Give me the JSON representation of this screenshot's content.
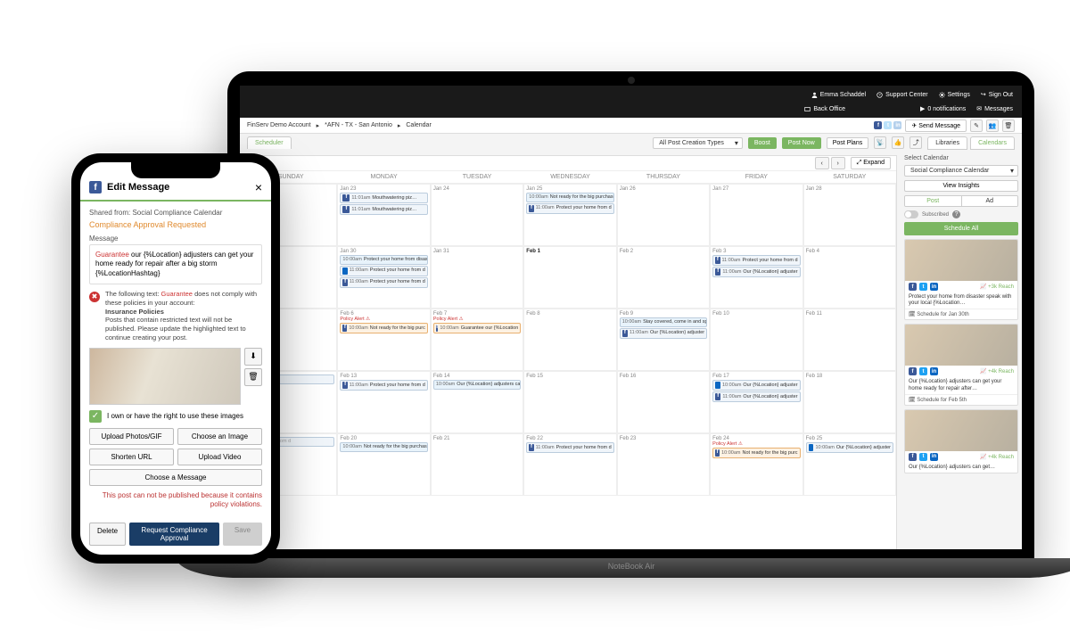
{
  "laptop_model": "NoteBook Air",
  "topbar": {
    "user": "Emma Schaddel",
    "back_office": "Back Office",
    "support": "Support Center",
    "settings": "Settings",
    "notifications": "0 notifications",
    "signout": "Sign Out",
    "messages": "Messages"
  },
  "breadcrumbs": {
    "account": "FinServ Demo Account",
    "location": "*AFN - TX - San Antonio",
    "page": "Calendar",
    "send_message": "Send Message"
  },
  "tabs": {
    "scheduler": "Scheduler",
    "library": "Libraries",
    "calendars": "Calendars"
  },
  "filters": {
    "creation_types": "All Post Creation Types",
    "boost": "Boost",
    "post_now": "Post Now",
    "post_plans": "Post Plans"
  },
  "calheader": {
    "expand": "Expand",
    "days": [
      "SUNDAY",
      "MONDAY",
      "TUESDAY",
      "WEDNESDAY",
      "THURSDAY",
      "FRIDAY",
      "SATURDAY"
    ]
  },
  "weeks": [
    [
      {
        "d": ""
      },
      {
        "d": "Jan 23",
        "ev": [
          {
            "t": "11:01am",
            "x": "Mouthwatering piz…",
            "n": "fb"
          },
          {
            "t": "11:01am",
            "x": "Mouthwatering piz…",
            "n": "fb"
          }
        ]
      },
      {
        "d": "Jan 24"
      },
      {
        "d": "Jan 25",
        "span": {
          "t": "10:00am",
          "x": "Not ready for the big purchase? Speak to {%Location} about our guarantee renters insurance"
        },
        "ev": [
          {
            "t": "11:00am",
            "x": "Protect your home from d",
            "n": "fb"
          }
        ]
      },
      {
        "d": "Jan 26"
      },
      {
        "d": "Jan 27"
      },
      {
        "d": "Jan 28"
      }
    ],
    [
      {
        "d": ""
      },
      {
        "d": "Jan 30",
        "span": {
          "t": "10:00am",
          "x": "Protect your home from disaster speak with your local {%Location} today"
        },
        "ev": [
          {
            "t": "11:00am",
            "x": "Protect your home from d",
            "n": "li"
          },
          {
            "t": "11:00am",
            "x": "Protect your home from d",
            "n": "fb"
          }
        ]
      },
      {
        "d": "Jan 31"
      },
      {
        "d": "Feb 1",
        "bold": true
      },
      {
        "d": "Feb 2"
      },
      {
        "d": "Feb 3",
        "ev": [
          {
            "t": "11:00am",
            "x": "Protect your home from d",
            "n": "fb"
          },
          {
            "t": "11:00am",
            "x": "Our {%Location} adjuster",
            "n": "fb"
          }
        ]
      },
      {
        "d": "Feb 4"
      }
    ],
    [
      {
        "d": ""
      },
      {
        "d": "Feb 6",
        "alert": "Policy Alert ⚠",
        "ev": [
          {
            "t": "10:00am",
            "x": "Not ready for the big purc",
            "n": "fb",
            "a": 1
          }
        ]
      },
      {
        "d": "Feb 7",
        "alert": "Policy Alert ⚠",
        "ev": [
          {
            "t": "10:00am",
            "x": "Guarantee our {%Location",
            "n": "fb",
            "a": 1
          }
        ]
      },
      {
        "d": "Feb 8"
      },
      {
        "d": "Feb 9",
        "span": {
          "t": "10:00am",
          "x": "Stay covered, come in and speak to {%Location} {%LocationLicenseNumber} to get a q"
        },
        "ev": [
          {
            "t": "11:00am",
            "x": "Our {%Location} adjuster",
            "n": "fb"
          }
        ]
      },
      {
        "d": "Feb 10"
      },
      {
        "d": "Feb 11"
      }
    ],
    [
      {
        "d": "",
        "txt": "wered, come i"
      },
      {
        "d": "Feb 13",
        "ev": [
          {
            "t": "11:00am",
            "x": "Protect your home from d",
            "n": "fb"
          }
        ]
      },
      {
        "d": "Feb 14",
        "span": {
          "t": "10:00am",
          "x": "Our {%Location} adjusters can get your home ready for repair after a big storm {%LocationHashtag}"
        }
      },
      {
        "d": "Feb 15"
      },
      {
        "d": "Feb 16"
      },
      {
        "d": "Feb 17",
        "ev": [
          {
            "t": "10:00am",
            "x": "Our {%Location} adjuster",
            "n": "li"
          },
          {
            "t": "11:00am",
            "x": "Our {%Location} adjuster",
            "n": "fb"
          }
        ]
      },
      {
        "d": "Feb 18"
      }
    ],
    [
      {
        "d": "",
        "txt": "t your home from d"
      },
      {
        "d": "Feb 20",
        "span": {
          "t": "10:00am",
          "x": "Not ready for the big purchase? Speak to {%Location} about our guarantee renters insurance"
        }
      },
      {
        "d": "Feb 21"
      },
      {
        "d": "Feb 22",
        "ev": [
          {
            "t": "11:00am",
            "x": "Protect your home from d",
            "n": "fb"
          }
        ]
      },
      {
        "d": "Feb 23"
      },
      {
        "d": "Feb 24",
        "alert": "Policy Alert ⚠",
        "ev": [
          {
            "t": "10:00am",
            "x": "Not ready for the big purc",
            "n": "fb",
            "a": 1
          }
        ]
      },
      {
        "d": "Feb 25",
        "ev": [
          {
            "t": "10:00am",
            "x": "Our {%Location} adjuster",
            "n": "li"
          }
        ]
      }
    ]
  ],
  "sidebar": {
    "select_label": "Select Calendar",
    "calendar": "Social Compliance Calendar",
    "insights": "View Insights",
    "post": "Post",
    "ad": "Ad",
    "subscribed": "Subscribed",
    "schedule_all": "Schedule All",
    "cards": [
      {
        "reach": "+3k Reach",
        "txt": "Protect your home from disaster speak with your local {%Location…",
        "btn": "Schedule for Jan 30th"
      },
      {
        "reach": "+4k Reach",
        "txt": "Our {%Location} adjusters can get your home ready for repair after…",
        "btn": "Schedule for Feb 5th"
      },
      {
        "reach": "+4k Reach",
        "txt": "Our {%Location} adjusters can get…",
        "btn": ""
      }
    ]
  },
  "phone": {
    "title": "Edit Message",
    "shared_from": "Shared from: Social Compliance Calendar",
    "approval": "Compliance Approval Requested",
    "msg_label": "Message",
    "msg_hl": "Guarantee",
    "msg_rest": " our {%Location} adjusters can get your home ready for repair after a big storm {%LocationHashtag}",
    "warning_pre": "The following text: ",
    "warning_hl": "Guarantee",
    "warning_post": " does not comply with these policies in your account:",
    "policy_name": "Insurance Policies",
    "policy_detail": "Posts that contain restricted text will not be published. Please update the highlighted text to continue creating your post.",
    "own_text": "I own or have the right to use these images",
    "buttons": {
      "upload_photos": "Upload Photos/GIF",
      "choose_image": "Choose an Image",
      "shorten_url": "Shorten URL",
      "upload_video": "Upload Video",
      "choose_message": "Choose a Message"
    },
    "error": "This post can not be published because it contains policy violations.",
    "footer": {
      "delete": "Delete",
      "request": "Request Compliance Approval",
      "save": "Save"
    }
  }
}
